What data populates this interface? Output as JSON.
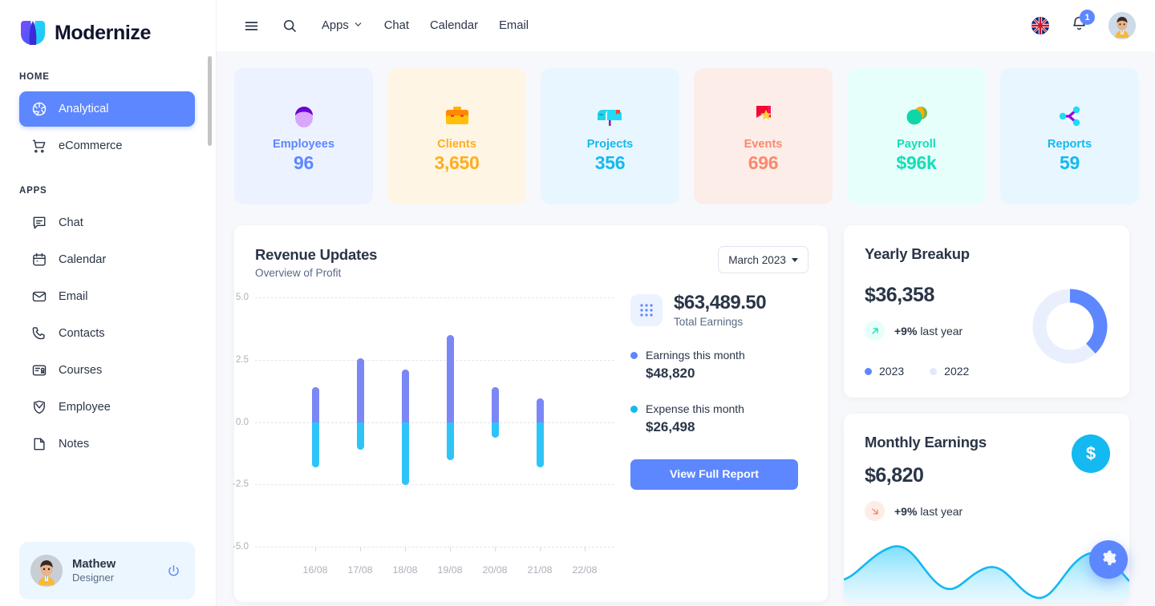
{
  "brand": {
    "name": "Modernize",
    "logo_icon": "modernize-logo"
  },
  "sidebar": {
    "sections": [
      {
        "label": "HOME",
        "items": [
          {
            "label": "Analytical",
            "icon": "aperture-icon",
            "active": true
          },
          {
            "label": "eCommerce",
            "icon": "shopping-cart-icon",
            "active": false
          }
        ]
      },
      {
        "label": "APPS",
        "items": [
          {
            "label": "Chat",
            "icon": "chat-bubble-icon",
            "active": false
          },
          {
            "label": "Calendar",
            "icon": "calendar-icon",
            "active": false
          },
          {
            "label": "Email",
            "icon": "envelope-icon",
            "active": false
          },
          {
            "label": "Contacts",
            "icon": "phone-icon",
            "active": false
          },
          {
            "label": "Courses",
            "icon": "certificate-icon",
            "active": false
          },
          {
            "label": "Employee",
            "icon": "shield-user-icon",
            "active": false
          },
          {
            "label": "Notes",
            "icon": "note-icon",
            "active": false
          }
        ]
      }
    ],
    "profile": {
      "name": "Mathew",
      "role": "Designer",
      "avatar_icon": "user-avatar",
      "power_icon": "power-icon"
    }
  },
  "topbar": {
    "menu_icon": "hamburger-menu-icon",
    "search_icon": "search-icon",
    "links": [
      {
        "label": "Apps",
        "has_caret": true
      },
      {
        "label": "Chat",
        "has_caret": false
      },
      {
        "label": "Calendar",
        "has_caret": false
      },
      {
        "label": "Email",
        "has_caret": false
      }
    ],
    "flag_icon": "uk-flag-icon",
    "bell_icon": "bell-icon",
    "notification_count": "1",
    "avatar_icon": "user-avatar"
  },
  "stats": [
    {
      "label": "Employees",
      "value": "96",
      "emoji": "👤",
      "bg": "#ecf2ff",
      "fg": "#5d87ff",
      "icon": "person-icon"
    },
    {
      "label": "Clients",
      "value": "3,650",
      "emoji": "💼",
      "bg": "#fef5e5",
      "fg": "#ffae1f",
      "icon": "briefcase-icon"
    },
    {
      "label": "Projects",
      "value": "356",
      "emoji": "📬",
      "bg": "#e8f7ff",
      "fg": "#13b9f0",
      "icon": "mailbox-icon"
    },
    {
      "label": "Events",
      "value": "696",
      "emoji": "🔖",
      "bg": "#fdede8",
      "fg": "#fa896b",
      "icon": "bookmark-star-icon"
    },
    {
      "label": "Payroll",
      "value": "$96k",
      "emoji": "💰",
      "bg": "#e6fffa",
      "fg": "#13deb9",
      "icon": "coins-icon"
    },
    {
      "label": "Reports",
      "value": "59",
      "emoji": "🔗",
      "bg": "#e8f7ff",
      "fg": "#13b9f0",
      "icon": "share-nodes-icon"
    }
  ],
  "revenue": {
    "title": "Revenue Updates",
    "subtitle": "Overview of Profit",
    "month_selected": "March 2023",
    "total_value": "$63,489.50",
    "total_caption": "Total Earnings",
    "grid_icon": "grid-dots-icon",
    "legend": [
      {
        "label": "Earnings this month",
        "value": "$48,820",
        "color": "#5d87ff"
      },
      {
        "label": "Expense this month",
        "value": "$26,498",
        "color": "#13b9f0"
      }
    ],
    "report_button": "View Full Report"
  },
  "chart_data": {
    "type": "bar",
    "title": "Revenue Updates",
    "subtitle": "Overview of Profit",
    "xlabel": "",
    "ylabel": "",
    "ylim": [
      -5.0,
      5.0
    ],
    "yticks": [
      5.0,
      2.5,
      0.0,
      -2.5,
      -5.0
    ],
    "ytick_labels": [
      "5.0",
      "2.5",
      "0.0",
      "-2.5",
      "-5.0"
    ],
    "categories": [
      "16/08",
      "17/08",
      "18/08",
      "19/08",
      "20/08",
      "21/08",
      "22/08"
    ],
    "grid": true,
    "legend_position": "right",
    "series": [
      {
        "name": "Earnings this month",
        "color": "#7b87f5",
        "values": [
          1.4,
          2.55,
          2.1,
          3.5,
          1.4,
          0.95,
          null
        ]
      },
      {
        "name": "Expense this month",
        "color": "#2ec4f8",
        "values": [
          -1.8,
          -1.1,
          -2.5,
          -1.5,
          -0.6,
          -1.8,
          null
        ]
      }
    ]
  },
  "yearly": {
    "title": "Yearly Breakup",
    "value": "$36,358",
    "delta": "+9%",
    "delta_suffix": "last year",
    "delta_icon": "arrow-up-right-icon",
    "legend": [
      {
        "label": "2023",
        "color": "#5d87ff"
      },
      {
        "label": "2022",
        "color": "#e2e8fb"
      }
    ],
    "donut": {
      "type": "donut",
      "series": [
        {
          "name": "2023",
          "value": 38
        },
        {
          "name": "2022",
          "value": 62
        }
      ]
    }
  },
  "monthly": {
    "title": "Monthly Earnings",
    "value": "$6,820",
    "delta": "+9%",
    "delta_suffix": "last year",
    "delta_icon": "arrow-down-right-icon",
    "fab_icon": "dollar-icon",
    "fab_symbol": "$"
  },
  "gear_fab": {
    "icon": "gear-icon"
  },
  "colors": {
    "primary": "#5d87ff",
    "info": "#13b9f0",
    "success": "#13deb9",
    "warning": "#ffae1f",
    "error": "#fa896b",
    "text": "#2a3547",
    "muted": "#5a6a85"
  }
}
